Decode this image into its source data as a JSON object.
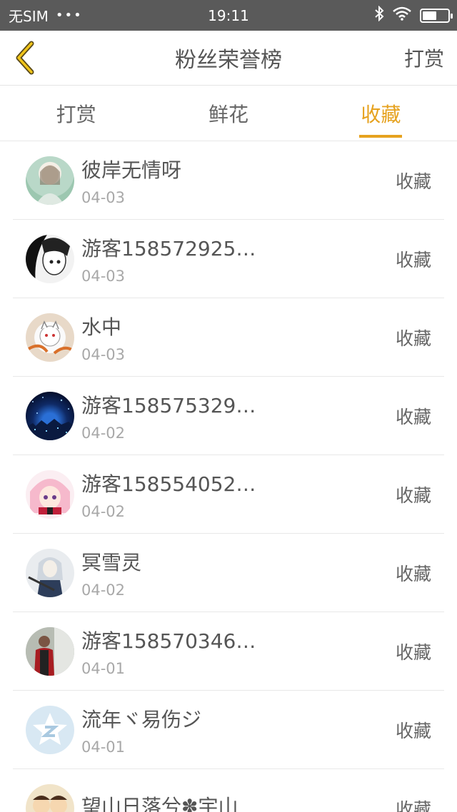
{
  "status_bar": {
    "carrier": "无SIM",
    "signal_dots": "•••",
    "time": "19:11"
  },
  "nav": {
    "title": "粉丝荣誉榜",
    "action": "打赏"
  },
  "tabs": [
    {
      "label": "打赏",
      "active": false
    },
    {
      "label": "鲜花",
      "active": false
    },
    {
      "label": "收藏",
      "active": true
    }
  ],
  "colors": {
    "accent": "#e6a21f",
    "status_bar_bg": "#5a5a5a"
  },
  "fans": [
    {
      "name": "彼岸无情呀",
      "date": "04-03",
      "type": "收藏",
      "avatar": "girl-portrait"
    },
    {
      "name": "游客158572925…",
      "date": "04-03",
      "type": "收藏",
      "avatar": "anime-girl-mono"
    },
    {
      "name": "水中",
      "date": "04-03",
      "type": "收藏",
      "avatar": "white-cat-art"
    },
    {
      "name": "游客158575329…",
      "date": "04-02",
      "type": "收藏",
      "avatar": "night-city"
    },
    {
      "name": "游客158554052…",
      "date": "04-02",
      "type": "收藏",
      "avatar": "pink-anime-girl"
    },
    {
      "name": "冥雪灵",
      "date": "04-02",
      "type": "收藏",
      "avatar": "anime-swordsman"
    },
    {
      "name": "游客158570346…",
      "date": "04-01",
      "type": "收藏",
      "avatar": "person-photo"
    },
    {
      "name": "流年ヾ易伤ジ",
      "date": "04-01",
      "type": "收藏",
      "avatar": "qzone-star-default"
    },
    {
      "name": "望山日落兮✽宇山",
      "date": "",
      "type": "收藏",
      "avatar": "cartoon-kids"
    }
  ]
}
